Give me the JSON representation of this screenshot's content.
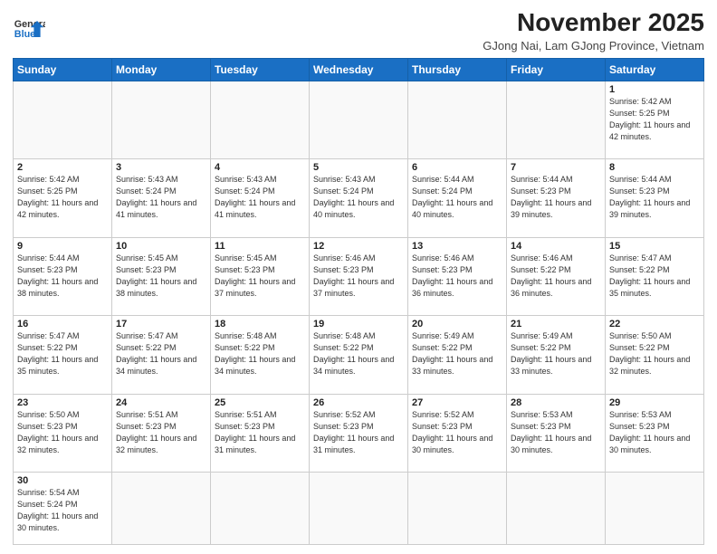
{
  "header": {
    "logo_line1": "General",
    "logo_line2": "Blue",
    "title": "November 2025",
    "subtitle": "GJong Nai, Lam GJong Province, Vietnam"
  },
  "weekdays": [
    "Sunday",
    "Monday",
    "Tuesday",
    "Wednesday",
    "Thursday",
    "Friday",
    "Saturday"
  ],
  "days": {
    "1": {
      "sunrise": "5:42 AM",
      "sunset": "5:25 PM",
      "daylight": "11 hours and 42 minutes."
    },
    "2": {
      "sunrise": "5:42 AM",
      "sunset": "5:25 PM",
      "daylight": "11 hours and 42 minutes."
    },
    "3": {
      "sunrise": "5:43 AM",
      "sunset": "5:24 PM",
      "daylight": "11 hours and 41 minutes."
    },
    "4": {
      "sunrise": "5:43 AM",
      "sunset": "5:24 PM",
      "daylight": "11 hours and 41 minutes."
    },
    "5": {
      "sunrise": "5:43 AM",
      "sunset": "5:24 PM",
      "daylight": "11 hours and 40 minutes."
    },
    "6": {
      "sunrise": "5:44 AM",
      "sunset": "5:24 PM",
      "daylight": "11 hours and 40 minutes."
    },
    "7": {
      "sunrise": "5:44 AM",
      "sunset": "5:23 PM",
      "daylight": "11 hours and 39 minutes."
    },
    "8": {
      "sunrise": "5:44 AM",
      "sunset": "5:23 PM",
      "daylight": "11 hours and 39 minutes."
    },
    "9": {
      "sunrise": "5:44 AM",
      "sunset": "5:23 PM",
      "daylight": "11 hours and 38 minutes."
    },
    "10": {
      "sunrise": "5:45 AM",
      "sunset": "5:23 PM",
      "daylight": "11 hours and 38 minutes."
    },
    "11": {
      "sunrise": "5:45 AM",
      "sunset": "5:23 PM",
      "daylight": "11 hours and 37 minutes."
    },
    "12": {
      "sunrise": "5:46 AM",
      "sunset": "5:23 PM",
      "daylight": "11 hours and 37 minutes."
    },
    "13": {
      "sunrise": "5:46 AM",
      "sunset": "5:23 PM",
      "daylight": "11 hours and 36 minutes."
    },
    "14": {
      "sunrise": "5:46 AM",
      "sunset": "5:22 PM",
      "daylight": "11 hours and 36 minutes."
    },
    "15": {
      "sunrise": "5:47 AM",
      "sunset": "5:22 PM",
      "daylight": "11 hours and 35 minutes."
    },
    "16": {
      "sunrise": "5:47 AM",
      "sunset": "5:22 PM",
      "daylight": "11 hours and 35 minutes."
    },
    "17": {
      "sunrise": "5:47 AM",
      "sunset": "5:22 PM",
      "daylight": "11 hours and 34 minutes."
    },
    "18": {
      "sunrise": "5:48 AM",
      "sunset": "5:22 PM",
      "daylight": "11 hours and 34 minutes."
    },
    "19": {
      "sunrise": "5:48 AM",
      "sunset": "5:22 PM",
      "daylight": "11 hours and 34 minutes."
    },
    "20": {
      "sunrise": "5:49 AM",
      "sunset": "5:22 PM",
      "daylight": "11 hours and 33 minutes."
    },
    "21": {
      "sunrise": "5:49 AM",
      "sunset": "5:22 PM",
      "daylight": "11 hours and 33 minutes."
    },
    "22": {
      "sunrise": "5:50 AM",
      "sunset": "5:22 PM",
      "daylight": "11 hours and 32 minutes."
    },
    "23": {
      "sunrise": "5:50 AM",
      "sunset": "5:23 PM",
      "daylight": "11 hours and 32 minutes."
    },
    "24": {
      "sunrise": "5:51 AM",
      "sunset": "5:23 PM",
      "daylight": "11 hours and 32 minutes."
    },
    "25": {
      "sunrise": "5:51 AM",
      "sunset": "5:23 PM",
      "daylight": "11 hours and 31 minutes."
    },
    "26": {
      "sunrise": "5:52 AM",
      "sunset": "5:23 PM",
      "daylight": "11 hours and 31 minutes."
    },
    "27": {
      "sunrise": "5:52 AM",
      "sunset": "5:23 PM",
      "daylight": "11 hours and 30 minutes."
    },
    "28": {
      "sunrise": "5:53 AM",
      "sunset": "5:23 PM",
      "daylight": "11 hours and 30 minutes."
    },
    "29": {
      "sunrise": "5:53 AM",
      "sunset": "5:23 PM",
      "daylight": "11 hours and 30 minutes."
    },
    "30": {
      "sunrise": "5:54 AM",
      "sunset": "5:24 PM",
      "daylight": "11 hours and 30 minutes."
    }
  },
  "labels": {
    "sunrise": "Sunrise:",
    "sunset": "Sunset:",
    "daylight": "Daylight:"
  }
}
